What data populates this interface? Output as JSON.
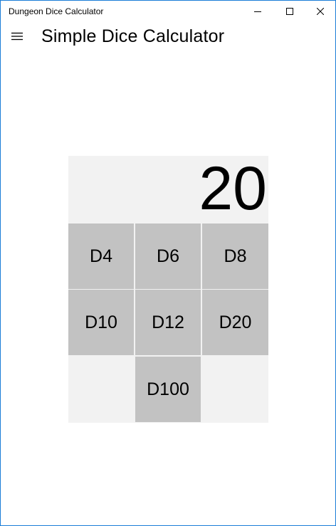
{
  "window": {
    "title": "Dungeon Dice Calculator",
    "controls": [
      "minimize-icon",
      "maximize-icon",
      "close-icon"
    ]
  },
  "header": {
    "menu_icon": "hamburger-menu-icon",
    "title": "Simple Dice Calculator"
  },
  "calculator": {
    "result": "20",
    "dice": [
      "D4",
      "D6",
      "D8",
      "D10",
      "D12",
      "D20",
      "D100"
    ]
  },
  "colors": {
    "accent_border": "#1a7dd7",
    "panel_background": "#f2f2f2",
    "button_background": "#c2c2c2",
    "text": "#000000"
  }
}
